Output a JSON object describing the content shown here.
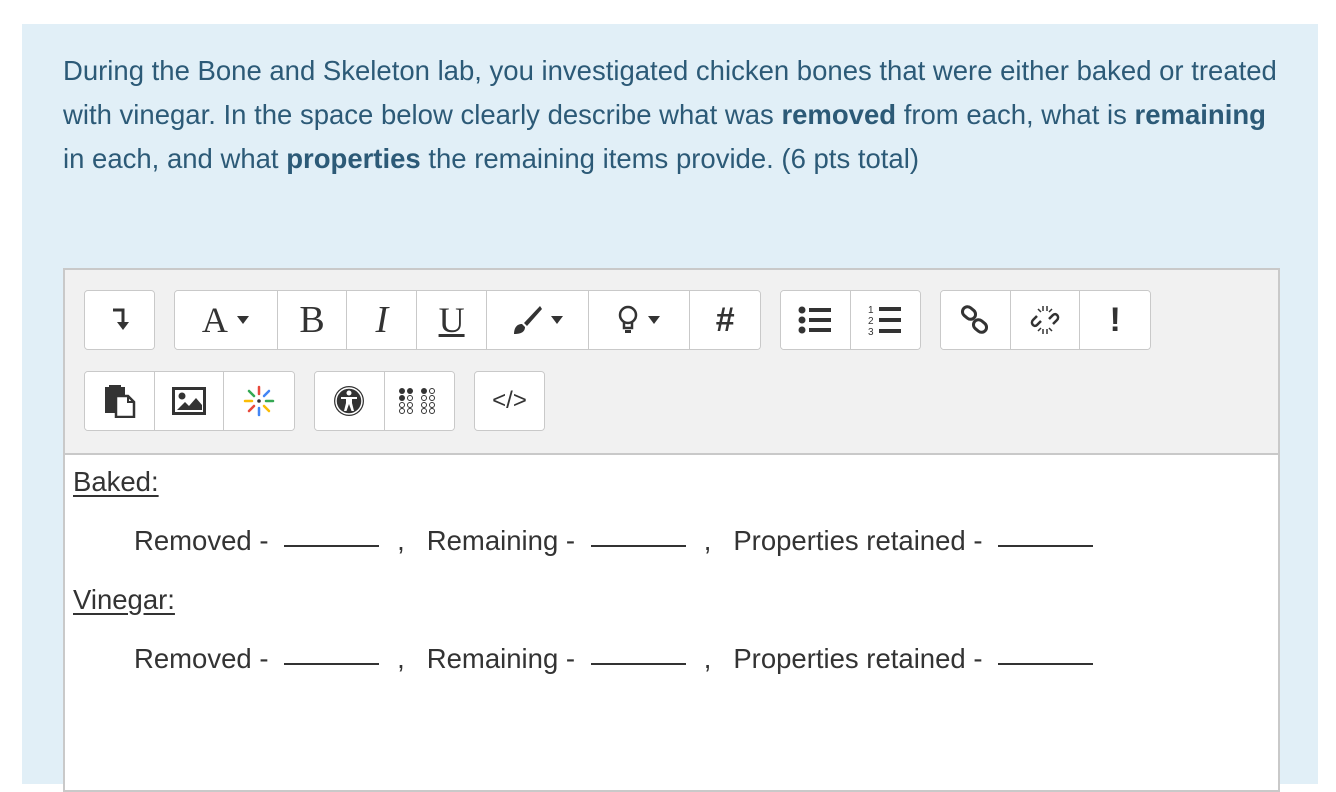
{
  "question": {
    "text_parts": [
      {
        "text": "During the Bone and Skeleton lab, you investigated chicken bones that were either baked or treated with vinegar.  In the space below clearly describe what was ",
        "bold": false
      },
      {
        "text": "removed",
        "bold": true
      },
      {
        "text": " from each, what is ",
        "bold": false
      },
      {
        "text": "remaining",
        "bold": true
      },
      {
        "text": " in each, and what ",
        "bold": false
      },
      {
        "text": "properties",
        "bold": true
      },
      {
        "text": " the remaining items provide. (6 pts total)",
        "bold": false
      }
    ]
  },
  "toolbar": {
    "row1": [
      [
        "toggle-toolbar-icon"
      ],
      [
        "font-size-icon",
        "bold-icon",
        "italic-icon",
        "underline-icon",
        "brush-icon",
        "lightbulb-icon",
        "hash-icon"
      ],
      [
        "bullet-list-icon",
        "numbered-list-icon"
      ],
      [
        "link-icon",
        "unlink-icon",
        "exclamation-icon"
      ]
    ],
    "row2": [
      [
        "paste-icon",
        "image-icon",
        "sparkle-icon"
      ],
      [
        "accessibility-icon",
        "braille-icon"
      ],
      [
        "code-icon"
      ]
    ],
    "labels": {
      "font": "A",
      "bold": "B",
      "italic": "I",
      "underline": "U",
      "hash": "#",
      "exclamation": "!",
      "code": "</>"
    }
  },
  "content": {
    "sections": [
      {
        "heading": "Baked:",
        "removed_label": "Removed - ",
        "remaining_label": "Remaining - ",
        "properties_label": "Properties retained - ",
        "separator": ","
      },
      {
        "heading": "Vinegar:",
        "removed_label": "Removed - ",
        "remaining_label": "Remaining - ",
        "properties_label": "Properties retained - ",
        "separator": ","
      }
    ]
  },
  "colors": {
    "question_bg": "#e1eff7",
    "question_text": "#2c5a77",
    "toolbar_bg": "#f1f1f1",
    "border": "#c9c9c9"
  }
}
